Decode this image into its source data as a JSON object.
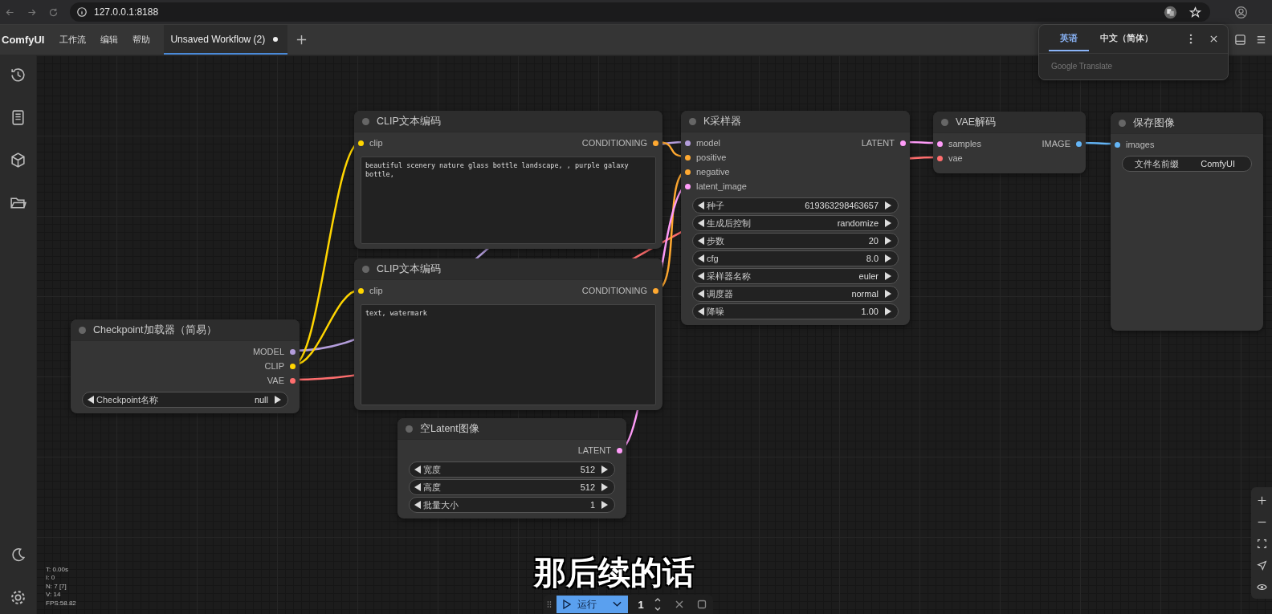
{
  "browser": {
    "url": "127.0.0.1:8188"
  },
  "menu": {
    "logo": "ComfyUI",
    "items": [
      "工作流",
      "编辑",
      "帮助"
    ],
    "tabs": [
      {
        "label": "Unsaved Workflow (2)",
        "selected": true,
        "unsaved": true
      }
    ]
  },
  "translate_popup": {
    "tabs": [
      {
        "label": "英语",
        "selected": true
      },
      {
        "label": "中文（简体）",
        "selected": false
      }
    ],
    "footer": "Google Translate"
  },
  "nodes": [
    {
      "title": "CLIP文本编码",
      "inputs": [
        {
          "name": "clip",
          "color": "#ffd500"
        }
      ],
      "outputs": [
        {
          "name": "CONDITIONING",
          "color": "#ffa931"
        }
      ],
      "widgets": [
        {
          "kind": "text",
          "value": "beautiful scenery nature glass bottle landscape, , purple galaxy bottle,"
        }
      ]
    },
    {
      "title": "K采样器",
      "inputs": [
        {
          "name": "model",
          "color": "#b39ddb"
        },
        {
          "name": "positive",
          "color": "#ffa931"
        },
        {
          "name": "negative",
          "color": "#ffa931"
        },
        {
          "name": "latent_image",
          "color": "#ff9cf9"
        }
      ],
      "outputs": [
        {
          "name": "LATENT",
          "color": "#ff9cf9"
        }
      ],
      "widgets": [
        {
          "kind": "number",
          "label": "种子",
          "value": "619363298463657"
        },
        {
          "kind": "combo",
          "label": "生成后控制",
          "value": "randomize"
        },
        {
          "kind": "number",
          "label": "步数",
          "value": "20"
        },
        {
          "kind": "number",
          "label": "cfg",
          "value": "8.0"
        },
        {
          "kind": "combo",
          "label": "采样器名称",
          "value": "euler"
        },
        {
          "kind": "combo",
          "label": "调度器",
          "value": "normal"
        },
        {
          "kind": "number",
          "label": "降噪",
          "value": "1.00"
        }
      ]
    },
    {
      "title": "VAE解码",
      "inputs": [
        {
          "name": "samples",
          "color": "#ff9cf9"
        },
        {
          "name": "vae",
          "color": "#ff6e6e"
        }
      ],
      "outputs": [
        {
          "name": "IMAGE",
          "color": "#64b5f6"
        }
      ]
    },
    {
      "title": "保存图像",
      "inputs": [
        {
          "name": "images",
          "color": "#64b5f6"
        }
      ],
      "widgets": [
        {
          "kind": "string",
          "label": "文件名前缀",
          "value": "ComfyUI"
        }
      ]
    },
    {
      "title": "CLIP文本编码",
      "inputs": [
        {
          "name": "clip",
          "color": "#ffd500"
        }
      ],
      "outputs": [
        {
          "name": "CONDITIONING",
          "color": "#ffa931"
        }
      ],
      "widgets": [
        {
          "kind": "text",
          "value": "text, watermark"
        }
      ]
    },
    {
      "title": "Checkpoint加载器（简易）",
      "outputs": [
        {
          "name": "MODEL",
          "color": "#b39ddb"
        },
        {
          "name": "CLIP",
          "color": "#ffd500"
        },
        {
          "name": "VAE",
          "color": "#ff6e6e"
        }
      ],
      "widgets": [
        {
          "kind": "combo",
          "label": "Checkpoint名称",
          "value": "null"
        }
      ]
    },
    {
      "title": "空Latent图像",
      "outputs": [
        {
          "name": "LATENT",
          "color": "#ff9cf9"
        }
      ],
      "widgets": [
        {
          "kind": "number",
          "label": "宽度",
          "value": "512"
        },
        {
          "kind": "number",
          "label": "高度",
          "value": "512"
        },
        {
          "kind": "number",
          "label": "批量大小",
          "value": "1"
        }
      ]
    }
  ],
  "stats": [
    "T: 0.00s",
    "I: 0",
    "N: 7 [7]",
    "V: 14",
    "FPS:58.82"
  ],
  "run_bar": {
    "label": "运行",
    "count": "1"
  },
  "subtitle": "那后续的话"
}
